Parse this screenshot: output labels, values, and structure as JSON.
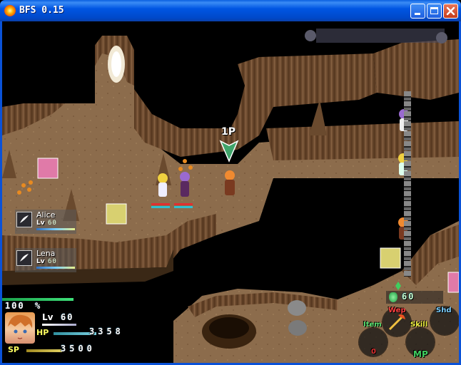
{
  "window": {
    "title": "BFS 0.15",
    "icon": "sun-app-icon",
    "buttons": [
      "minimize",
      "maximize",
      "close"
    ]
  },
  "scene": {
    "floating_marker": "1P",
    "sidebar_glyph": "∞∞∞∞"
  },
  "party": [
    {
      "name": "Alice",
      "level_tag": "Lv",
      "level": "60"
    },
    {
      "name": "Lena",
      "level_tag": "Lv",
      "level": "60"
    }
  ],
  "hud": {
    "exp_percent": "100",
    "percent_sign": "%",
    "level_tag": "Lv",
    "level": "60",
    "hp_tag": "HP",
    "hp": "3358",
    "sp_tag": "SP",
    "sp": "3500",
    "exp_fill": 1.0
  },
  "right_hud": {
    "gem_count": "60",
    "wep_label": "Wep",
    "shd_label": "Shd",
    "item_label": "Item",
    "skill_label": "Skill",
    "item_count": "0",
    "mp_label": "MP"
  },
  "colors": {
    "cave_floor": "#8a6a48",
    "cliff": "#6b4a30",
    "chasm": "#000000",
    "hp_bar": "#e03030",
    "mp_bar": "#30c0d0",
    "accent_green": "#3fcf5f"
  }
}
